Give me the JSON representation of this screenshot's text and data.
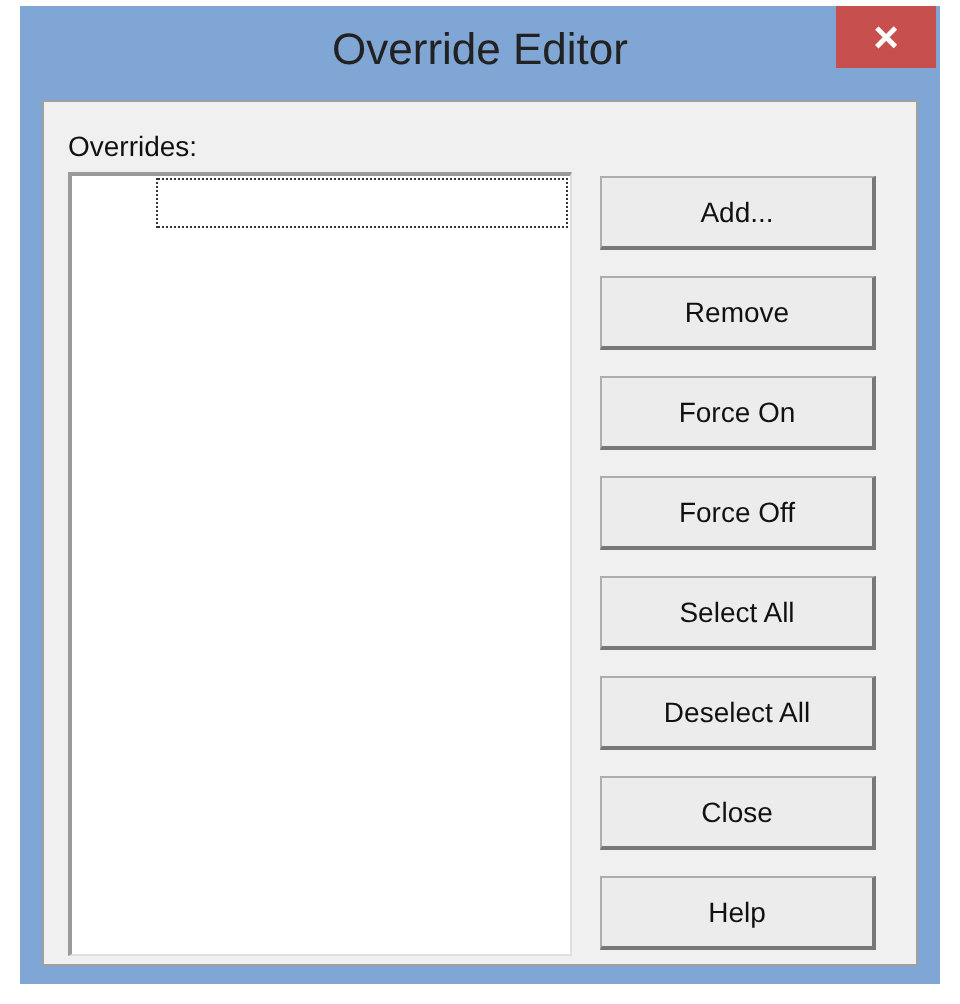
{
  "window": {
    "title": "Override Editor",
    "close_glyph": "×"
  },
  "overrides": {
    "label": "Overrides:"
  },
  "buttons": [
    "Add...",
    "Remove",
    "Force On",
    "Force Off",
    "Select All",
    "Deselect All",
    "Close",
    "Help"
  ]
}
